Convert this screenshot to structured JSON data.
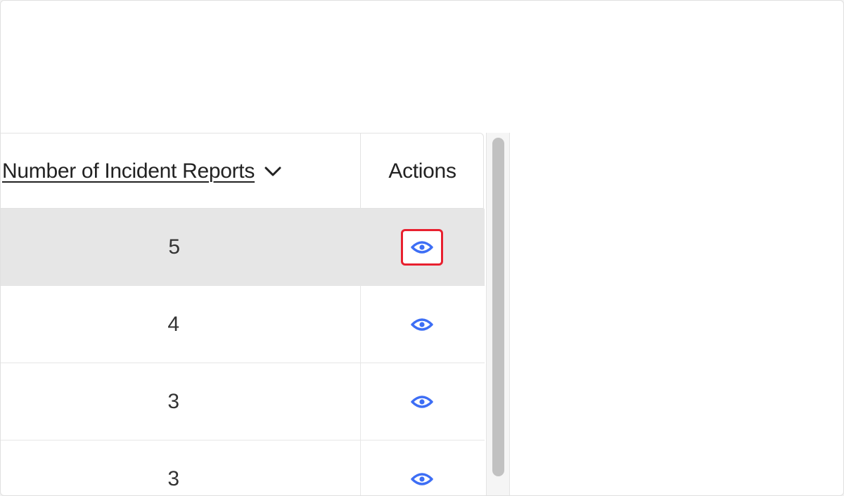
{
  "table": {
    "columns": {
      "count_header": "Number of Incident Reports ",
      "actions_header": "Actions"
    },
    "sort_icon": "chevron-down-icon",
    "action_icon": "eye-icon",
    "rows": [
      {
        "count": "5",
        "highlighted": true,
        "focused": true
      },
      {
        "count": "4"
      },
      {
        "count": "3"
      },
      {
        "count": "3"
      }
    ]
  },
  "colors": {
    "accent": "#3d6ef5",
    "focus_outline": "#e8202f",
    "highlight_row": "#e6e6e6"
  }
}
